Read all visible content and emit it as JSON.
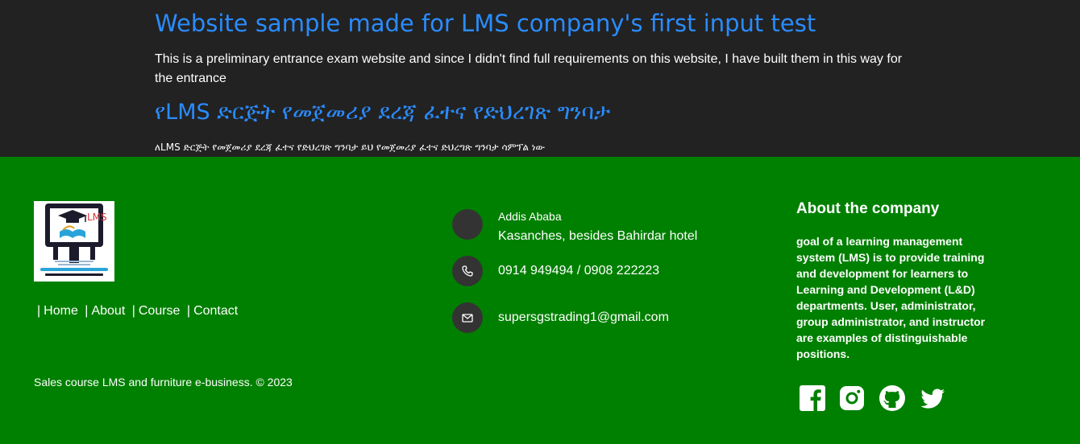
{
  "header": {
    "title": "Website sample made for LMS company's first input test",
    "description": "This is a preliminary entrance exam website and since I didn't find full requirements on this website, I have built them in this way for the entrance",
    "title_am": "የLMS ድርጅት የመጀመሪያ ደረጃ ፈተና የድህረገጽ ግንባታ",
    "description_am": "ለLMS ድርጅት የመጀመሪያ ደረጃ ፈተና የድህረገጽ ግንባታ ይህ የመጀመሪያ ፈተና ድህረግጽ ግንባታ ሳምፕል ነው"
  },
  "footer": {
    "logo_text": "LMS",
    "nav": {
      "separator": "|",
      "items": [
        "Home",
        "About",
        "Course",
        "Contact"
      ]
    },
    "copyright": "Sales course LMS and furniture e-business. © 2023",
    "contact": {
      "city": "Addis Ababa",
      "address": "Kasanches, besides Bahirdar hotel",
      "phone": "0914 949494 / 0908 222223",
      "email": "supersgstrading1@gmail.com"
    },
    "about": {
      "title": "About the company",
      "text": "goal of a learning management system (LMS) is to provide training and development for learners to Learning and Development (L&D) departments. User, administrator, group administrator, and instructor are examples of distinguishable positions."
    },
    "social_icons": [
      "facebook-icon",
      "instagram-icon",
      "github-icon",
      "twitter-icon"
    ]
  },
  "colors": {
    "top_bg": "#222222",
    "heading": "#2a8cff",
    "footer_bg": "#008000",
    "icon_circle": "#333333"
  }
}
